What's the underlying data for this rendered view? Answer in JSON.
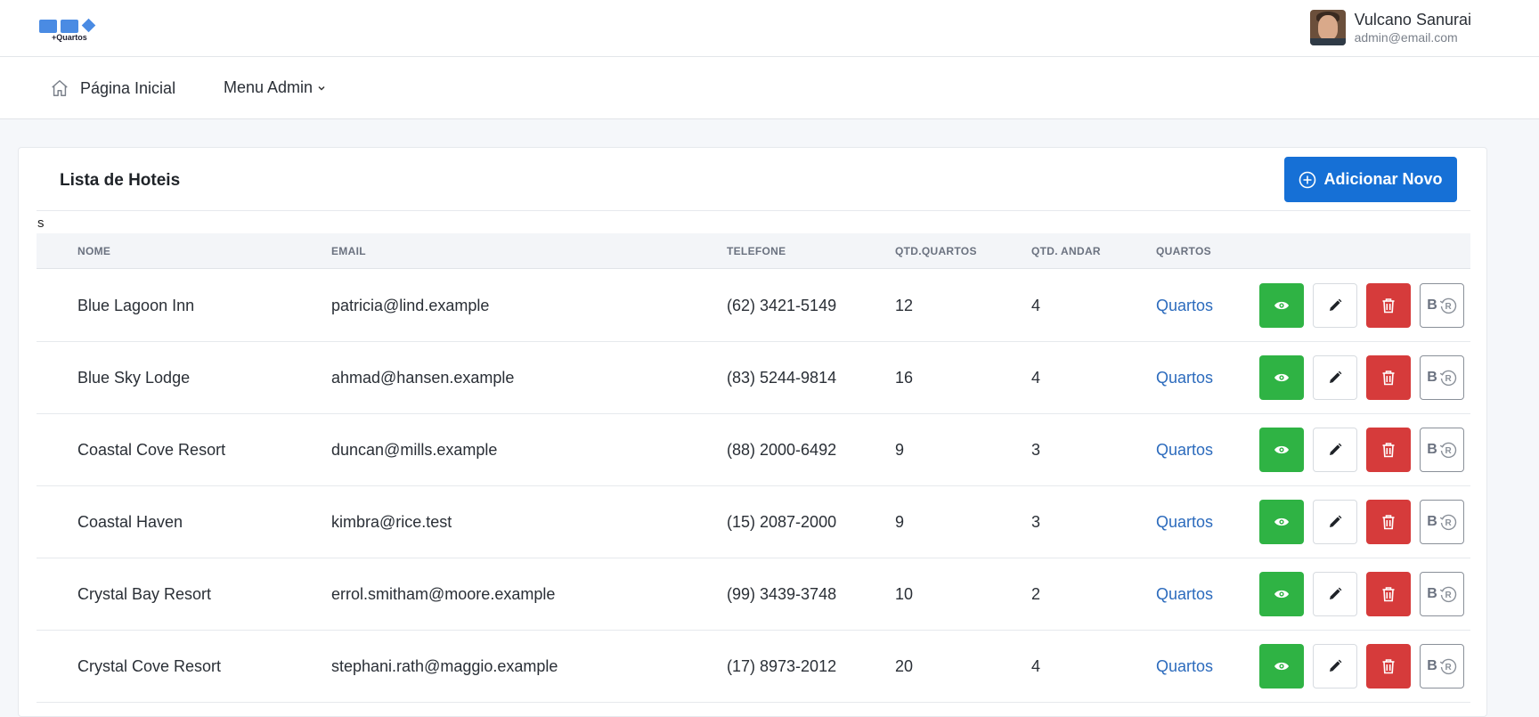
{
  "app": {
    "logo_text": "+Quartos"
  },
  "user": {
    "name": "Vulcano Sanurai",
    "email": "admin@email.com"
  },
  "nav": {
    "home_label": "Página Inicial",
    "admin_label": "Menu Admin"
  },
  "page": {
    "title": "Lista de Hoteis",
    "add_button_label": "Adicionar Novo",
    "stray_text": "s"
  },
  "table": {
    "headers": [
      "NOME",
      "EMAIL",
      "TELEFONE",
      "QTD.QUARTOS",
      "QTD. ANDAR",
      "QUARTOS"
    ],
    "rooms_link_label": "Quartos",
    "booking_button_label": "B",
    "rows": [
      {
        "name": "Blue Lagoon Inn",
        "email": "patricia@lind.example",
        "phone": "(62) 3421-5149",
        "rooms": "12",
        "floors": "4"
      },
      {
        "name": "Blue Sky Lodge",
        "email": "ahmad@hansen.example",
        "phone": "(83) 5244-9814",
        "rooms": "16",
        "floors": "4"
      },
      {
        "name": "Coastal Cove Resort",
        "email": "duncan@mills.example",
        "phone": "(88) 2000-6492",
        "rooms": "9",
        "floors": "3"
      },
      {
        "name": "Coastal Haven",
        "email": "kimbra@rice.test",
        "phone": "(15) 2087-2000",
        "rooms": "9",
        "floors": "3"
      },
      {
        "name": "Crystal Bay Resort",
        "email": "errol.smitham@moore.example",
        "phone": "(99) 3439-3748",
        "rooms": "10",
        "floors": "2"
      },
      {
        "name": "Crystal Cove Resort",
        "email": "stephani.rath@maggio.example",
        "phone": "(17) 8973-2012",
        "rooms": "20",
        "floors": "4"
      }
    ]
  },
  "colors": {
    "primary": "#1670d6",
    "view": "#2fb344",
    "delete": "#d63b3b",
    "link": "#2c6bbd"
  },
  "icons": {
    "home": "home-icon",
    "chevron": "chevron-down-icon",
    "add": "plus-circle-icon",
    "view": "eye-icon",
    "edit": "pencil-icon",
    "delete": "trash-icon",
    "booking": "registered-icon"
  }
}
